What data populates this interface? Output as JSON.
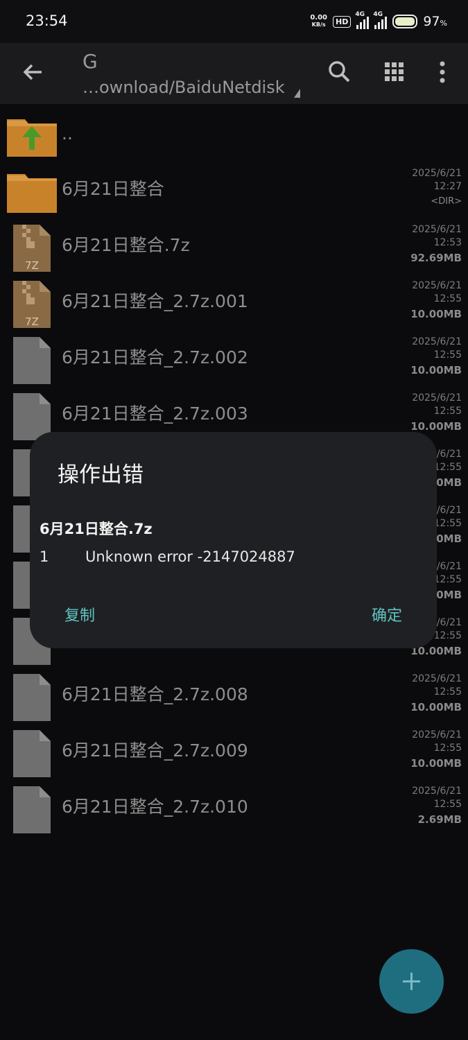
{
  "status": {
    "time": "23:54",
    "net_speed_value": "0.00",
    "net_speed_unit": "KB/s",
    "hd_label": "HD",
    "net1": "4G",
    "net2": "4G",
    "battery_value": "97",
    "battery_unit": "%"
  },
  "toolbar": {
    "drive": "G",
    "path": "…ownload/BaiduNetdisk",
    "icons": [
      "back-arrow-icon",
      "search-icon",
      "grid-view-icon",
      "more-vert-icon"
    ]
  },
  "files": [
    {
      "name": "..",
      "type": "up"
    },
    {
      "name": "6月21日整合",
      "type": "folder",
      "date": "2025/6/21",
      "time": "12:27",
      "size": "<DIR>"
    },
    {
      "name": "6月21日整合.7z",
      "type": "7z",
      "date": "2025/6/21",
      "time": "12:53",
      "size": "92.69MB"
    },
    {
      "name": "6月21日整合_2.7z.001",
      "type": "7z",
      "date": "2025/6/21",
      "time": "12:55",
      "size": "10.00MB"
    },
    {
      "name": "6月21日整合_2.7z.002",
      "type": "file",
      "date": "2025/6/21",
      "time": "12:55",
      "size": "10.00MB"
    },
    {
      "name": "6月21日整合_2.7z.003",
      "type": "file",
      "date": "2025/6/21",
      "time": "12:55",
      "size": "10.00MB"
    },
    {
      "name": "",
      "type": "file",
      "date": "/6/21",
      "time": "12:55",
      "size": "00MB"
    },
    {
      "name": "",
      "type": "file",
      "date": "/6/21",
      "time": "12:55",
      "size": "00MB"
    },
    {
      "name": "",
      "type": "file",
      "date": "/6/21",
      "time": "12:55",
      "size": "00MB"
    },
    {
      "name": "",
      "type": "file",
      "date": "/6/21",
      "time": "12:55",
      "size": "10.00MB"
    },
    {
      "name": "6月21日整合_2.7z.008",
      "type": "file",
      "date": "2025/6/21",
      "time": "12:55",
      "size": "10.00MB"
    },
    {
      "name": "6月21日整合_2.7z.009",
      "type": "file",
      "date": "2025/6/21",
      "time": "12:55",
      "size": "10.00MB"
    },
    {
      "name": "6月21日整合_2.7z.010",
      "type": "file",
      "date": "2025/6/21",
      "time": "12:55",
      "size": "2.69MB"
    }
  ],
  "dialog": {
    "title": "操作出错",
    "file": "6月21日整合.7z",
    "error_num": "1",
    "error_text": "Unknown error -2147024887",
    "copy_label": "复制",
    "ok_label": "确定"
  },
  "fab": {
    "icon": "plus-icon"
  },
  "colors": {
    "accent": "#5fc4c4",
    "folder": "#c8832a",
    "fab": "#1f6e80"
  }
}
